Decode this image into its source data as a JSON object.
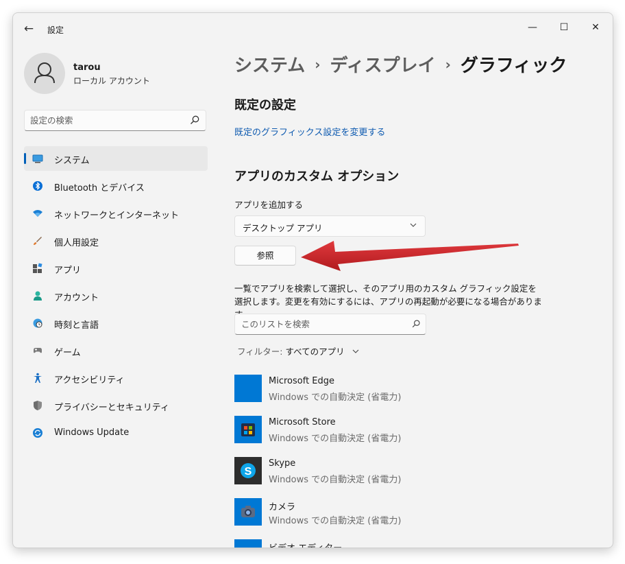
{
  "window": {
    "title": "設定",
    "controls": {
      "minimize": "—",
      "maximize": "☐",
      "close": "✕"
    }
  },
  "user": {
    "name": "tarou",
    "account_type": "ローカル アカウント"
  },
  "sidebar": {
    "search_placeholder": "設定の検索",
    "items": [
      {
        "label": "システム",
        "icon": "system-icon",
        "selected": true
      },
      {
        "label": "Bluetooth とデバイス",
        "icon": "bluetooth-icon"
      },
      {
        "label": "ネットワークとインターネット",
        "icon": "wifi-icon"
      },
      {
        "label": "個人用設定",
        "icon": "brush-icon"
      },
      {
        "label": "アプリ",
        "icon": "apps-icon"
      },
      {
        "label": "アカウント",
        "icon": "account-icon"
      },
      {
        "label": "時刻と言語",
        "icon": "globe-clock-icon"
      },
      {
        "label": "ゲーム",
        "icon": "gamepad-icon"
      },
      {
        "label": "アクセシビリティ",
        "icon": "accessibility-icon"
      },
      {
        "label": "プライバシーとセキュリティ",
        "icon": "shield-icon"
      },
      {
        "label": "Windows Update",
        "icon": "update-icon"
      }
    ]
  },
  "breadcrumb": {
    "level1": "システム",
    "level2": "ディスプレイ",
    "current": "グラフィック",
    "separator": "›"
  },
  "main": {
    "default_section_title": "既定の設定",
    "default_link": "既定のグラフィックス設定を変更する",
    "custom_section_title": "アプリのカスタム オプション",
    "add_app_label": "アプリを追加する",
    "app_type_selected": "デスクトップ アプリ",
    "browse_button": "参照",
    "description": "一覧でアプリを検索して選択し、そのアプリ用のカスタム グラフィック設定を選択します。変更を有効にするには、アプリの再起動が必要になる場合があります。",
    "list_search_placeholder": "このリストを検索",
    "filter_label": "フィルター:",
    "filter_value": "すべてのアプリ"
  },
  "apps": [
    {
      "name": "Microsoft Edge",
      "status": "Windows での自動決定 (省電力)",
      "icon": "edge-tile"
    },
    {
      "name": "Microsoft Store",
      "status": "Windows での自動決定 (省電力)",
      "icon": "store-icon"
    },
    {
      "name": "Skype",
      "status": "Windows での自動決定 (省電力)",
      "icon": "skype-icon"
    },
    {
      "name": "カメラ",
      "status": "Windows での自動決定 (省電力)",
      "icon": "camera-icon"
    },
    {
      "name": "ビデオ エディター",
      "status": "",
      "icon": "video-editor-icon"
    }
  ],
  "colors": {
    "accent": "#005fb8",
    "link": "#0f5bb0",
    "tile": "#0078d4",
    "skype": "#2d2d2d",
    "arrow": "#c8262a"
  }
}
